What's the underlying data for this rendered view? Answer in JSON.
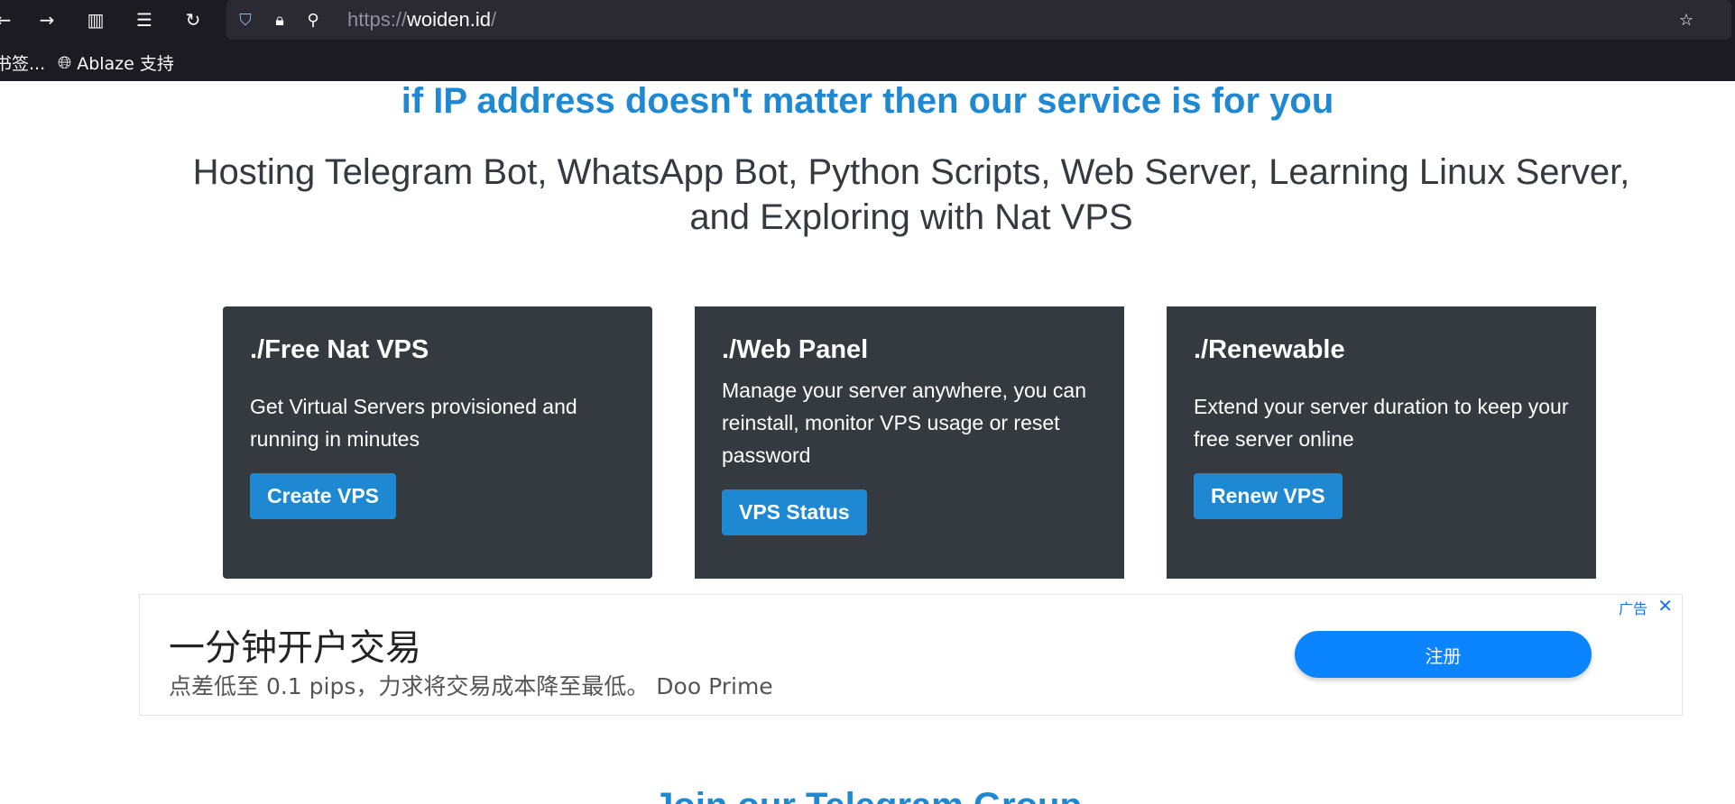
{
  "browser": {
    "url_scheme": "https://",
    "url_host": "woiden.id",
    "url_path": "/",
    "bookmarks": [
      "书签...",
      "Ablaze 支持"
    ]
  },
  "page": {
    "headline": "if IP address doesn't matter then our service is for you",
    "subhead": "Hosting Telegram Bot, WhatsApp Bot, Python Scripts, Web Server, Learning Linux Server, and Exploring with Nat VPS",
    "cards": [
      {
        "title": "./Free Nat VPS",
        "text": "Get Virtual Servers provisioned and running in minutes",
        "button": "Create VPS"
      },
      {
        "title": "./Web Panel",
        "text": "Manage your server anywhere, you can reinstall, monitor VPS usage or reset password",
        "button": "VPS Status"
      },
      {
        "title": "./Renewable",
        "text": "Extend your server duration to keep your free server online",
        "button": "Renew VPS"
      }
    ],
    "ad": {
      "title": "一分钟开户交易",
      "desc": "点差低至 0.1 pips，力求将交易成本降至最低。 Doo Prime",
      "label": "广告",
      "button": "注册"
    },
    "bottom_peek": "Join our Telegram Group"
  },
  "colors": {
    "accent": "#1e88d3",
    "card_bg": "#343a40",
    "ad_button": "#0a84ff"
  }
}
